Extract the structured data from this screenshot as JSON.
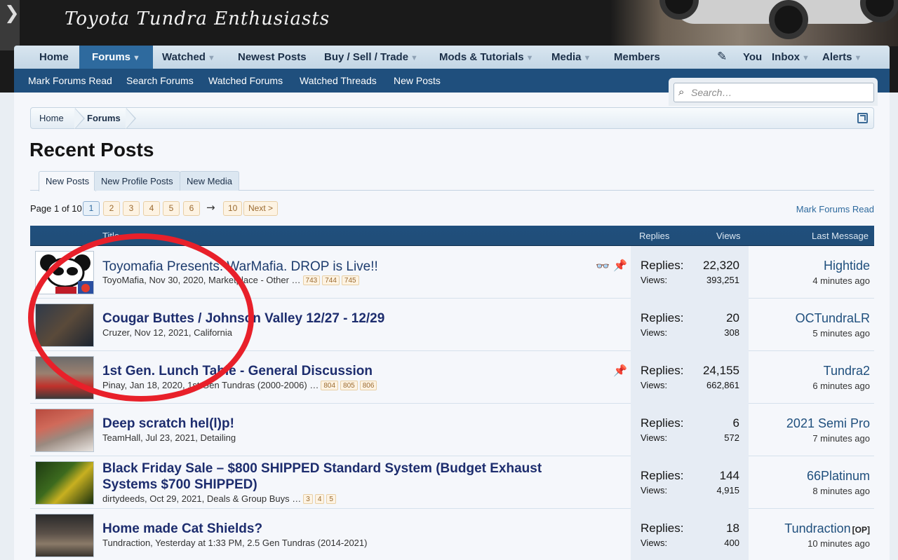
{
  "header": {
    "tagline": "Toyota Tundra Enthusiasts"
  },
  "nav": {
    "items": [
      {
        "label": "Home",
        "dropdown": false
      },
      {
        "label": "Forums",
        "dropdown": true,
        "active": true
      },
      {
        "label": "Watched",
        "dropdown": true
      },
      {
        "label": "Newest Posts",
        "dropdown": false
      },
      {
        "label": "Buy / Sell / Trade",
        "dropdown": true
      },
      {
        "label": "Mods & Tutorials",
        "dropdown": true
      },
      {
        "label": "Media",
        "dropdown": true
      },
      {
        "label": "Members",
        "dropdown": false
      }
    ],
    "user": {
      "you": "You",
      "inbox": "Inbox",
      "alerts": "Alerts"
    }
  },
  "subnav": {
    "items": [
      "Mark Forums Read",
      "Search Forums",
      "Watched Forums",
      "Watched Threads",
      "New Posts"
    ]
  },
  "search": {
    "placeholder": "Search…"
  },
  "breadcrumb": [
    "Home",
    "Forums"
  ],
  "page_title": "Recent Posts",
  "tabs": [
    "New Posts",
    "New Profile Posts",
    "New Media"
  ],
  "pager": {
    "label": "Page 1 of 10",
    "pages": [
      "1",
      "2",
      "3",
      "4",
      "5",
      "6"
    ],
    "arrow": "→",
    "last": "10",
    "next": "Next >",
    "mark_read": "Mark Forums Read"
  },
  "table": {
    "headers": {
      "title": "Title",
      "replies": "Replies",
      "views": "Views",
      "last": "Last Message"
    },
    "stat_labels": {
      "replies": "Replies:",
      "views": "Views:"
    },
    "rows": [
      {
        "title": "Toyomafia Presents: WarMafia. DROP is Live!!",
        "bold": false,
        "meta": "ToyoMafia, Nov 30, 2020, Marketplace - Other",
        "pages": [
          "743",
          "744",
          "745"
        ],
        "replies": "22,320",
        "views": "393,251",
        "last_user": "Hightide",
        "last_time": "4 minutes ago",
        "icons": [
          "watch-icon",
          "pin-icon"
        ]
      },
      {
        "title": "Cougar Buttes / Johnson Valley 12/27 - 12/29",
        "bold": true,
        "meta": "Cruzer, Nov 12, 2021, California",
        "pages": [],
        "replies": "20",
        "views": "308",
        "last_user": "OCTundraLR",
        "last_time": "5 minutes ago",
        "icons": []
      },
      {
        "title": "1st Gen. Lunch Table - General Discussion",
        "bold": true,
        "meta": "Pinay, Jan 18, 2020, 1st Gen Tundras (2000-2006)",
        "pages": [
          "804",
          "805",
          "806"
        ],
        "replies": "24,155",
        "views": "662,861",
        "last_user": "Tundra2",
        "last_time": "6 minutes ago",
        "icons": [
          "pin-icon"
        ]
      },
      {
        "title": "Deep scratch hel(l)p!",
        "bold": true,
        "meta": "TeamHall, Jul 23, 2021, Detailing",
        "pages": [],
        "replies": "6",
        "views": "572",
        "last_user": "2021 Semi Pro",
        "last_time": "7 minutes ago",
        "icons": []
      },
      {
        "title_line1": "Black Friday Sale – $800 SHIPPED Standard System (Budget Exhaust",
        "title_line2": "Systems $700 SHIPPED)",
        "bold": true,
        "meta": "dirtydeeds, Oct 29, 2021, Deals & Group Buys",
        "pages": [
          "3",
          "4",
          "5"
        ],
        "replies": "144",
        "views": "4,915",
        "last_user": "66Platinum",
        "last_time": "8 minutes ago",
        "icons": []
      },
      {
        "title": "Home made Cat Shields?",
        "bold": true,
        "meta": "Tundraction, Yesterday at 1:33 PM, 2.5 Gen Tundras (2014-2021)",
        "pages": [],
        "replies": "18",
        "views": "400",
        "last_user": "Tundraction",
        "last_user_badge": "[OP]",
        "last_time": "10 minutes ago",
        "icons": []
      }
    ]
  },
  "colors": {
    "accent": "#1f4f7d",
    "annotation": "#e8202a",
    "title_link": "#1d2d6e"
  },
  "ellipsis": "…"
}
